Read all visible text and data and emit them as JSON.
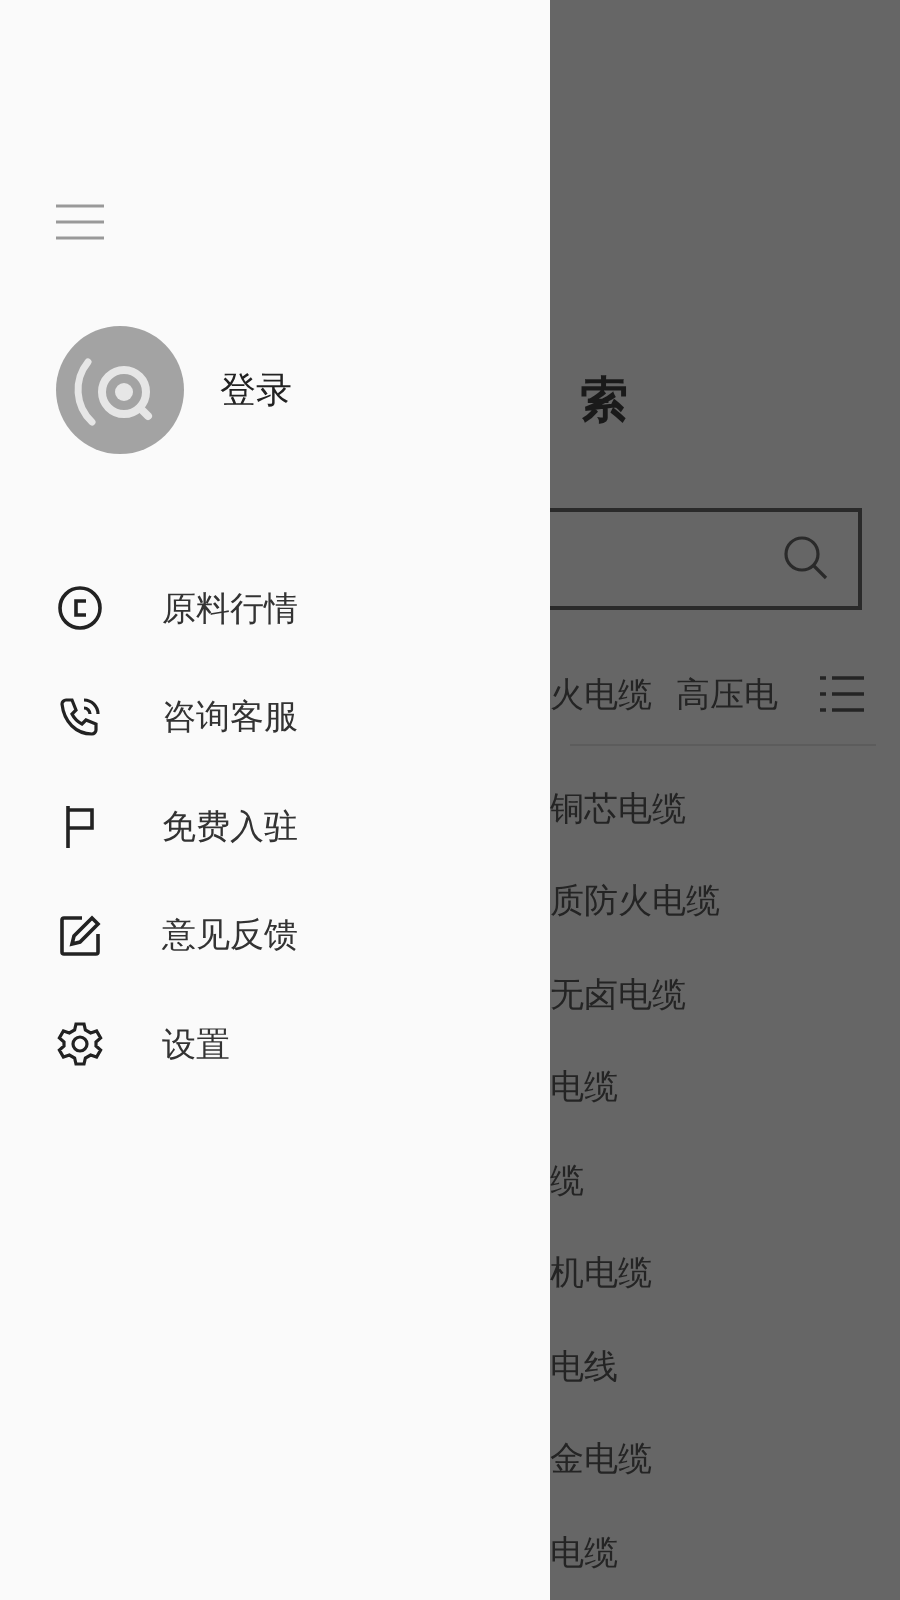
{
  "drawer": {
    "user": {
      "label": "登录"
    },
    "items": [
      {
        "kind": "copyright",
        "label": "原料行情"
      },
      {
        "kind": "phone",
        "label": "咨询客服"
      },
      {
        "kind": "flag",
        "label": "免费入驻"
      },
      {
        "kind": "edit",
        "label": "意见反馈"
      },
      {
        "kind": "settings",
        "label": "设置"
      }
    ]
  },
  "background": {
    "title": "索",
    "tabs": [
      "火电缆",
      "高压电"
    ],
    "items": [
      "铜芯电缆",
      "质防火电缆",
      "无卤电缆",
      "电缆",
      "缆",
      "机电缆",
      "电线",
      "金电缆",
      "电缆"
    ]
  }
}
